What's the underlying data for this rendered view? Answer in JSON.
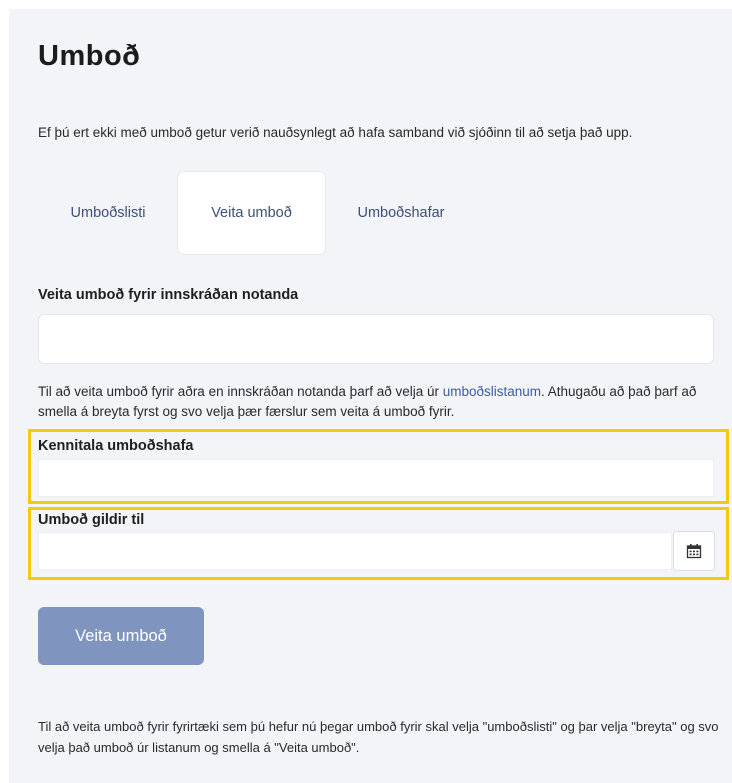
{
  "page": {
    "title": "Umboð",
    "intro": "Ef þú ert ekki með umboð getur verið nauðsynlegt að hafa samband við sjóðinn til að setja það upp."
  },
  "tabs": [
    {
      "label": "Umboðslisti",
      "active": false
    },
    {
      "label": "Veita umboð",
      "active": true
    },
    {
      "label": "Umboðshafar",
      "active": false
    }
  ],
  "form": {
    "logged_in_label": "Veita umboð fyrir innskráðan notanda",
    "logged_in_value": "",
    "help_before": "Til að veita umboð fyrir aðra en innskráðan notanda þarf að velja úr ",
    "help_link": "umboðslistanum",
    "help_after": ". Athugaðu að það þarf að smella á breyta fyrst og svo velja þær færslur sem veita á umboð fyrir.",
    "kennitala_label": "Kennitala umboðshafa",
    "kennitala_value": "",
    "valid_until_label": "Umboð gildir til",
    "valid_until_value": "",
    "calendar_icon": "calendar-icon",
    "submit_label": "Veita umboð",
    "footer_text": "Til að veita umboð fyrir fyrirtæki sem þú hefur nú þegar umboð fyrir skal velja \"umboðslisti\" og þar velja \"breyta\" og svo velja það umboð úr listanum og smella á \"Veita umboð\"."
  },
  "colors": {
    "accent": "#3e5aa8",
    "button": "#8094c0",
    "highlight": "#f6c90e",
    "panel": "#f2f4f8"
  }
}
